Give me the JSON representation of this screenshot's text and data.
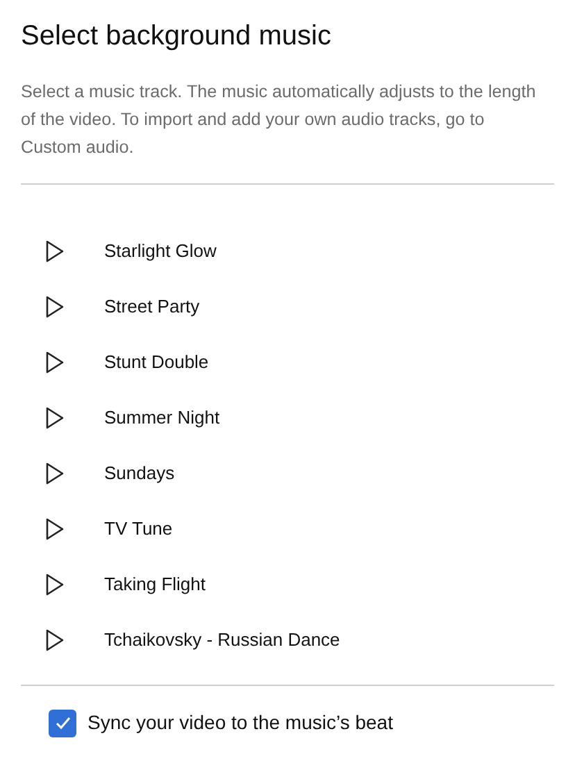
{
  "title": "Select background music",
  "description": "Select a music track. The music automatically adjusts to the length of the video. To import and add your own audio tracks, go to Custom audio.",
  "tracks": [
    {
      "name": "Starlight Glow"
    },
    {
      "name": "Street Party"
    },
    {
      "name": "Stunt Double"
    },
    {
      "name": "Summer Night"
    },
    {
      "name": "Sundays"
    },
    {
      "name": "TV Tune"
    },
    {
      "name": "Taking Flight"
    },
    {
      "name": "Tchaikovsky - Russian Dance"
    }
  ],
  "sync": {
    "label": "Sync your video to the music’s beat",
    "checked": true
  }
}
